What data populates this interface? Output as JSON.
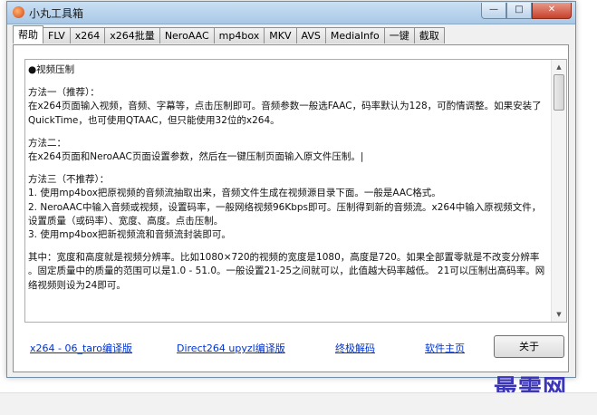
{
  "window": {
    "title": "小丸工具箱",
    "minimize_glyph": "—",
    "maximize_glyph": "□",
    "close_glyph": "✕"
  },
  "tabs": [
    {
      "label": "帮助",
      "active": true
    },
    {
      "label": "FLV"
    },
    {
      "label": "x264"
    },
    {
      "label": "x264批量"
    },
    {
      "label": "NeroAAC"
    },
    {
      "label": "mp4box"
    },
    {
      "label": "MKV"
    },
    {
      "label": "AVS"
    },
    {
      "label": "MediaInfo"
    },
    {
      "label": "一键"
    },
    {
      "label": "截取"
    }
  ],
  "help_text": {
    "heading": "●视频压制",
    "m1_title": "方法一（推荐）：",
    "m1_line1": "在x264页面输入视频，音频、字幕等，点击压制即可。音频参数一般选FAAC，码率默认为128，可酌情调整。如果安装了",
    "m1_line2": "QuickTime，也可使用QTAAC，但只能使用32位的x264。",
    "m2_title": "方法二：",
    "m2_line1": "在x264页面和NeroAAC页面设置参数，然后在一键压制页面输入原文件压制。|",
    "m3_title": "方法三（不推荐）：",
    "m3_line1": "1. 使用mp4box把原视频的音频流抽取出来，音频文件生成在视频源目录下面。一般是AAC格式。",
    "m3_line2": "2. NeroAAC中输入音频或视频，设置码率，一般网络视频96Kbps即可。压制得到新的音频流。x264中输入原视频文件，",
    "m3_line3": "设置质量（或码率）、宽度、高度。点击压制。",
    "m3_line4": "3. 使用mp4box把新视频流和音频流封装即可。",
    "note_line1": "其中：宽度和高度就是视频分辨率。比如1080×720的视频的宽度是1080，高度是720。如果全部置零就是不改变分辨率",
    "note_line2": "。固定质量中的质量的范围可以是1.0 - 51.0。一般设置21-25之间就可以，此值越大码率越低。 21可以压制出高码率。网",
    "note_line3": "络视频则设为24即可。"
  },
  "links": {
    "x264_taro": "x264 - 06_taro编译版",
    "direct264": "Direct264 upyzl编译版",
    "ultimate_decoder": "终极解码",
    "homepage": "软件主页"
  },
  "about_button": "关于",
  "watermark": "最需网"
}
